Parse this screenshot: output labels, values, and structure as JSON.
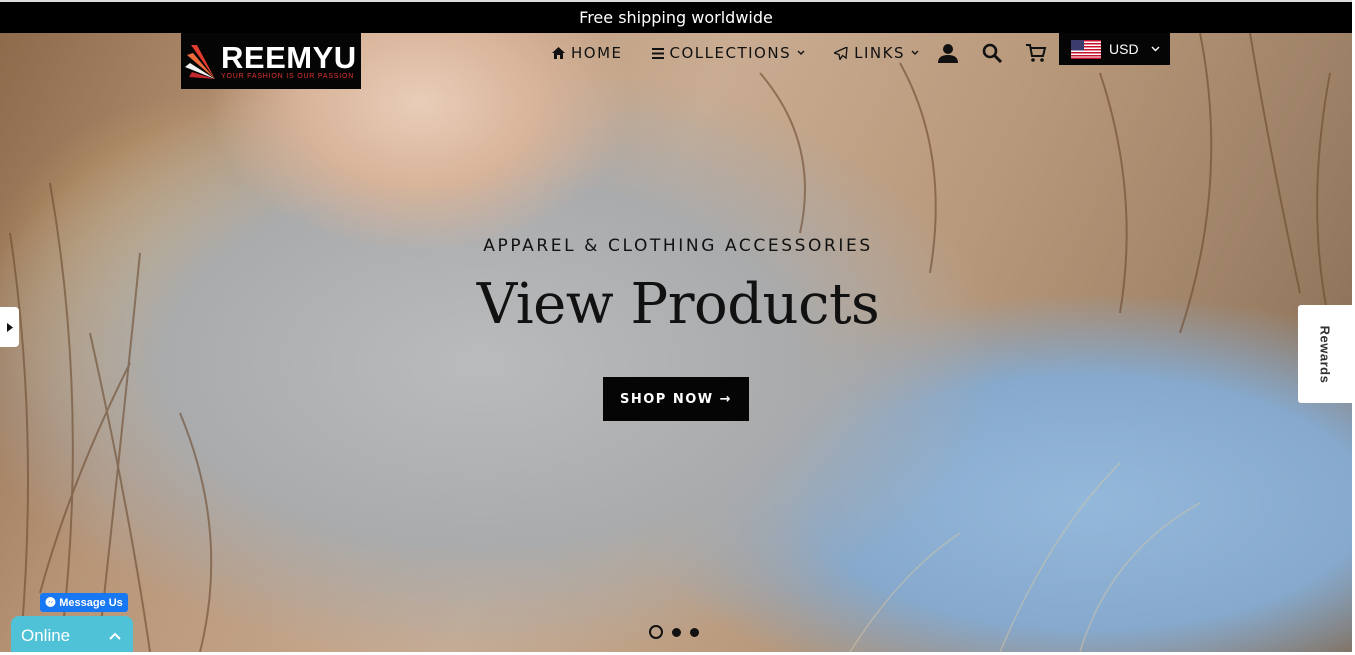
{
  "announcement": "Free shipping worldwide",
  "logo": {
    "name": "REEMYU",
    "tagline": "YOUR FASHION IS OUR PASSION"
  },
  "nav": {
    "home": "HOME",
    "collections": "COLLECTIONS",
    "links": "LINKS"
  },
  "icons": [
    "home-icon",
    "menu-icon",
    "send-icon",
    "user-icon",
    "search-icon",
    "cart-icon",
    "us-flag-icon",
    "chevron-down-icon",
    "chevron-up-icon",
    "messenger-icon",
    "arrow-right-icon"
  ],
  "currency": {
    "code": "USD"
  },
  "hero": {
    "eyebrow": "APPAREL & CLOTHING ACCESSORIES",
    "headline": "View Products",
    "cta": "SHOP NOW →"
  },
  "slider": {
    "count": 3,
    "active": 1
  },
  "rewards": "Rewards",
  "messenger": "Message Us",
  "chat": {
    "status": "Online"
  },
  "colors": {
    "accent": "#050505",
    "chat": "#4fc2d7",
    "messenger": "#1877f2"
  }
}
